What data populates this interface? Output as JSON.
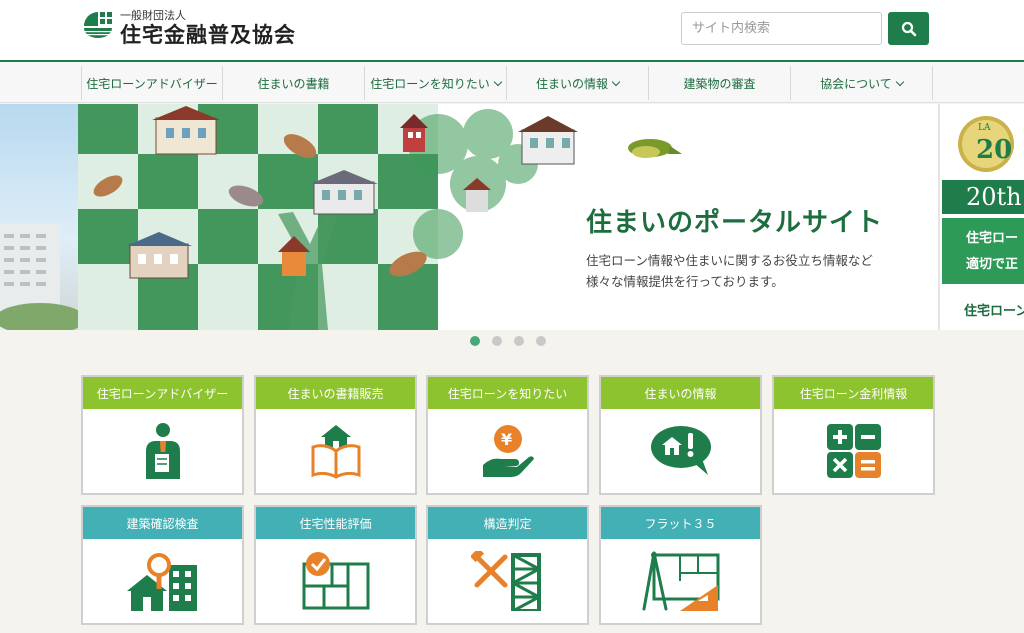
{
  "header": {
    "org_type": "一般財団法人",
    "org_name": "住宅金融普及協会",
    "search_placeholder": "サイト内検索"
  },
  "nav": {
    "items": [
      {
        "label": "住宅ローンアドバイザー",
        "dropdown": false
      },
      {
        "label": "住まいの書籍",
        "dropdown": false
      },
      {
        "label": "住宅ローンを知りたい",
        "dropdown": true
      },
      {
        "label": "住まいの情報",
        "dropdown": true
      },
      {
        "label": "建築物の審査",
        "dropdown": false
      },
      {
        "label": "協会について",
        "dropdown": true
      }
    ]
  },
  "hero": {
    "title": "住まいのポータルサイト",
    "desc_line1": "住宅ローン情報や住まいに関するお役立ち情報など",
    "desc_line2": "様々な情報提供を行っております。",
    "next_slide": {
      "badge": "20th",
      "line1": "住宅ロー",
      "line2": "適切で正",
      "link": "住宅ローン"
    },
    "slides_total": 4,
    "active_slide": 1
  },
  "cards_row1": [
    {
      "label": "住宅ローンアドバイザー",
      "icon": "advisor-icon"
    },
    {
      "label": "住まいの書籍販売",
      "icon": "book-house-icon"
    },
    {
      "label": "住宅ローンを知りたい",
      "icon": "yen-hand-icon"
    },
    {
      "label": "住まいの情報",
      "icon": "info-bubble-icon"
    },
    {
      "label": "住宅ローン金利情報",
      "icon": "calculator-icon"
    }
  ],
  "cards_row2": [
    {
      "label": "建築確認検査",
      "icon": "building-inspect-icon"
    },
    {
      "label": "住宅性能評価",
      "icon": "floorplan-check-icon"
    },
    {
      "label": "構造判定",
      "icon": "tools-structure-icon"
    },
    {
      "label": "フラット３５",
      "icon": "compass-plan-icon"
    }
  ],
  "colors": {
    "brand_green": "#1e7d4a",
    "card_green": "#8dc32e",
    "card_teal": "#43b0b5",
    "icon_orange": "#e8822a"
  }
}
